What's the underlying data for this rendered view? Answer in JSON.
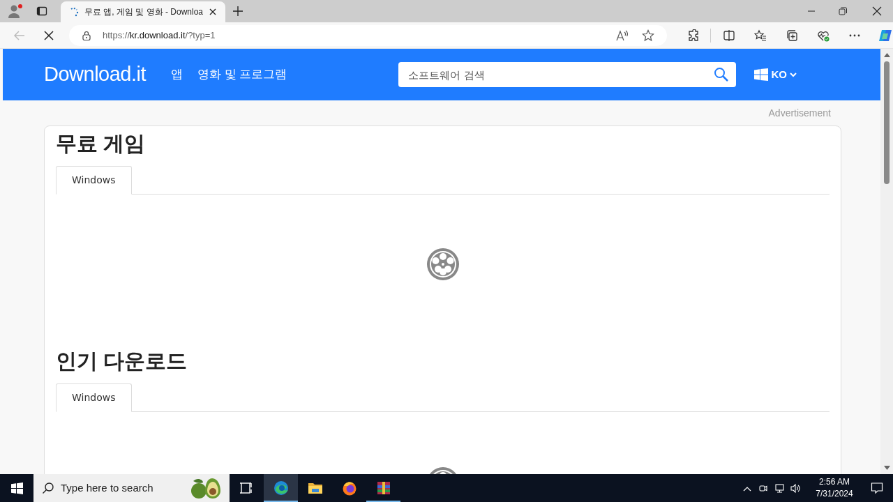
{
  "browser": {
    "tab": {
      "title": "무료 앱, 게임 및 영화 - Downloa",
      "loading": true
    },
    "url": {
      "scheme": "https://",
      "host": "kr.download.it",
      "path": "/?typ=1"
    }
  },
  "site": {
    "logo": "Download.it",
    "nav": [
      "앱",
      "영화 및 프로그램"
    ],
    "search": {
      "placeholder": "소프트웨어 검색"
    },
    "language": "KO",
    "advertisement": "Advertisement"
  },
  "sections": [
    {
      "title": "무료 게임",
      "tabs": [
        {
          "label": "Windows",
          "selected": true
        }
      ],
      "loading": true
    },
    {
      "title": "인기 다운로드",
      "tabs": [
        {
          "label": "Windows",
          "selected": true
        }
      ],
      "loading": true
    }
  ],
  "taskbar": {
    "search": {
      "placeholder": "Type here to search"
    },
    "apps": [
      {
        "kind": "taskview",
        "running": false,
        "selected": false
      },
      {
        "kind": "edge",
        "running": true,
        "selected": true
      },
      {
        "kind": "explorer",
        "running": false,
        "selected": false
      },
      {
        "kind": "firefox",
        "running": false,
        "selected": false
      },
      {
        "kind": "archive",
        "running": true,
        "selected": false
      }
    ],
    "time": "2:56 AM",
    "date": "7/31/2024"
  }
}
